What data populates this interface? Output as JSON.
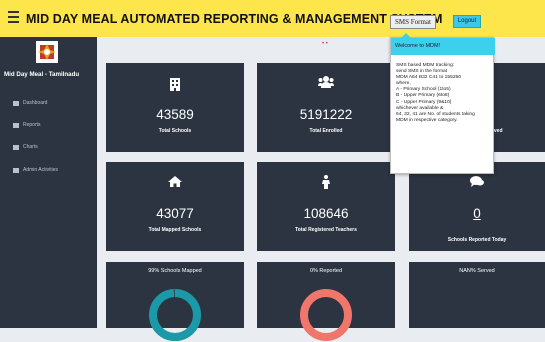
{
  "header": {
    "title": "MID DAY MEAL AUTOMATED REPORTING & MANAGEMENT SYSTEM",
    "sms_button": "SMS Format",
    "logout_button": "Logout",
    "bg_color": "#fde64b"
  },
  "sidebar": {
    "state_name": "Mid Day Meal - Tamilnadu",
    "items": [
      {
        "label": "Dashboard",
        "icon": "dashboard-icon"
      },
      {
        "label": "Reports",
        "icon": "list-icon"
      },
      {
        "label": "Charts",
        "icon": "list-icon"
      },
      {
        "label": "Admin Activities",
        "icon": "list-icon"
      }
    ]
  },
  "main": {
    "indicator": "• •",
    "stats": [
      {
        "icon": "building-icon",
        "value": "43589",
        "label": "Total Schools"
      },
      {
        "icon": "users-icon",
        "value": "5191222",
        "label": "Total Enrolled"
      },
      {
        "label": "...erved"
      },
      {
        "icon": "home-icon",
        "value": "43077",
        "label": "Total Mapped Schools"
      },
      {
        "icon": "person-icon",
        "value": "108646",
        "label": "Total Registered Teachers"
      },
      {
        "icon": "comments-icon",
        "value": "0",
        "label": "Schools Reported Today"
      }
    ],
    "progress": [
      {
        "title": "99% Schools Mapped",
        "percent": 99,
        "color": "#1a9aa8"
      },
      {
        "title": "0% Reported",
        "percent": 0,
        "color": "#f0766b"
      },
      {
        "title": "NAN% Served",
        "percent": 0,
        "color": "#ffffff"
      }
    ]
  },
  "tooltip": {
    "title": "Welcome to MDM!",
    "lines": [
      "SMS based MDM tracking:",
      "send SMS in the format",
      "MDM A64 B32 C41 to 155250",
      "where,",
      "A - Primary School (1to5)",
      "B - Upper Primary (6to8)",
      "C - Upper Primary (9&10)",
      "whichever available &",
      "64, 32, 41 are No. of students taking",
      "MDM in respective category."
    ]
  }
}
